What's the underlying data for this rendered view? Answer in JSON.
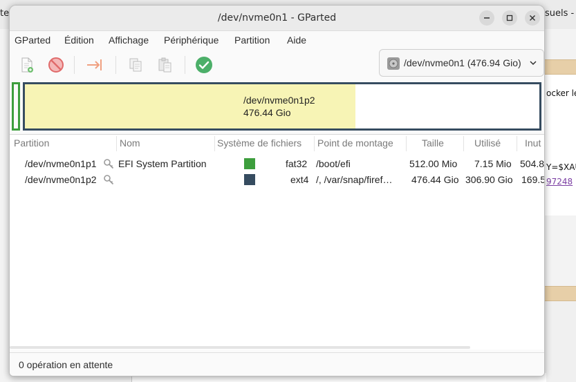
{
  "background": {
    "tab_left_text": "te",
    "tab_right_text": "suels -",
    "page_text_1": "ocker le",
    "page_text_2": "Y=$XAU",
    "page_link": "97248"
  },
  "window": {
    "title": "/dev/nvme0n1 - GParted"
  },
  "menubar": {
    "items": [
      "GParted",
      "Édition",
      "Affichage",
      "Périphérique",
      "Partition",
      "Aide"
    ]
  },
  "toolbar": {
    "icons": [
      "new-partition-icon",
      "delete-partition-icon",
      "resize-move-icon",
      "copy-icon",
      "paste-icon",
      "apply-icon"
    ],
    "device_selector": "/dev/nvme0n1 (476.94 Gio)"
  },
  "disk_map": {
    "partition_name": "/dev/nvme0n1p2",
    "partition_size": "476.44 Gio",
    "used_fraction": 0.643,
    "colors": {
      "efi_border": "#3d9e3d",
      "main_border": "#364c60",
      "used_fill": "#f7f4b5"
    }
  },
  "table": {
    "columns": [
      "Partition",
      "Nom",
      "Système de fichiers",
      "Point de montage",
      "Taille",
      "Utilisé",
      "Inut"
    ],
    "rows": [
      {
        "partition": "/dev/nvme0n1p1",
        "name": "EFI System Partition",
        "fs_color": "#3d9e3d",
        "filesystem": "fat32",
        "mountpoint": "/boot/efi",
        "size": "512.00 Mio",
        "used": "7.15 Mio",
        "unused": "504.8"
      },
      {
        "partition": "/dev/nvme0n1p2",
        "name": "",
        "fs_color": "#364c60",
        "filesystem": "ext4",
        "mountpoint": "/, /var/snap/firef…",
        "size": "476.44 Gio",
        "used": "306.90 Gio",
        "unused": "169.5"
      }
    ]
  },
  "statusbar": {
    "text": "0 opération en attente"
  }
}
